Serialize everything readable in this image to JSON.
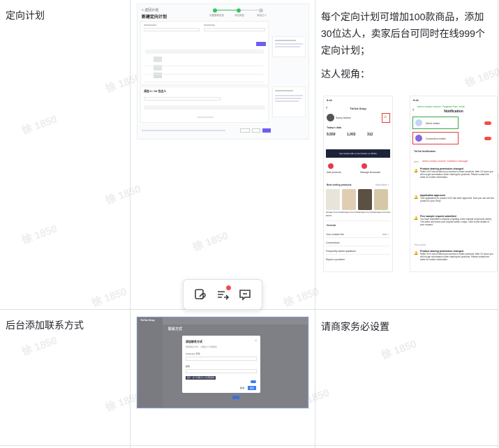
{
  "rows": [
    {
      "label": "定向计划",
      "paragraphs": [
        "每个定向计划可增加100款商品，添加30位达人，卖家后台可同时在线999个定向计划；",
        "达人视角："
      ]
    },
    {
      "label": "后台添加联系方式",
      "paragraphs": [
        "请商家务必设置"
      ]
    }
  ],
  "watermark": "徐 1850",
  "toolbar": {
    "link_icon": "link-icon",
    "share_icon": "share-list-icon",
    "comment_icon": "comment-icon",
    "badge_color": "#f54a45"
  },
  "screenshot1": {
    "breadcrumb": "< 返回计划",
    "title": "新建定向计划",
    "steps": [
      "设置基础信息",
      "添加商品",
      "添加达人"
    ],
    "section_title": "添加 0 / 30 位达人",
    "primary_color": "#6e5ef0",
    "next": "下一步",
    "prev": "上一步",
    "submit": "提交"
  },
  "phoneA": {
    "time": "9:41",
    "title": "TikTok Shop",
    "user": "Sunny Adams",
    "section": "Today's data",
    "stats": [
      "9,550",
      "1,002",
      "312"
    ],
    "banner": "Get started with a commission on TikTok",
    "actions": [
      "Add products",
      "Manage showcase"
    ],
    "best_selling": "Best selling products",
    "view_more": "View More >",
    "products": [
      "Heritage Crew Sock",
      "Heritage Crew Sock",
      "Heritage Crew Sock",
      "Heritage Crew Sock"
    ],
    "price": "$29.99",
    "general": "General",
    "menu": [
      "Your contact info",
      "Connections",
      "Frequently asked questions",
      "Report a problem"
    ],
    "add_label": "Add >"
  },
  "phoneB": {
    "time": "9:41",
    "title": "Notification",
    "ann_green": "where creator receive \"Targeted Plan\" invite",
    "ann_red": "where creator receive \"invitation message\"",
    "items": [
      "Direct invites",
      "Connection invites"
    ],
    "section": "TikTok Notification",
    "new_label": "New",
    "this_month": "This month",
    "notifications": [
      {
        "title": "Product sharing permission changed",
        "body": "Seller XXX has revoked your access to share products. After 24 hours you will not get commission when sharing the products. Please contact the seller for further information."
      },
      {
        "title": "Application approved",
        "body": "Your application for product XXX has been approved. Now you can see the product in your Shop."
      },
      {
        "title": "Free sample request submitted",
        "body": "You have submitted a request of getting a free sample of [product name]. The seller will review your request within x days. Click to see details of your request."
      },
      {
        "title": "Product sharing permission changed",
        "body": "Seller XXX has revoked your access to share products. After 24 hours you will not get commission when sharing the products. Please contact the seller for further information."
      }
    ]
  },
  "screenshot2": {
    "app_name": "TikTok Shop",
    "page_title": "联系方式",
    "modal_title": "添加联系方式",
    "modal_desc": "添加联系方式，以便达人与你联系",
    "field1_label": "WhatsApp 号码",
    "field2_label": "邮箱",
    "tip": "提示：达人可通过以上方式联系你",
    "cancel": "取消",
    "confirm": "保存"
  }
}
